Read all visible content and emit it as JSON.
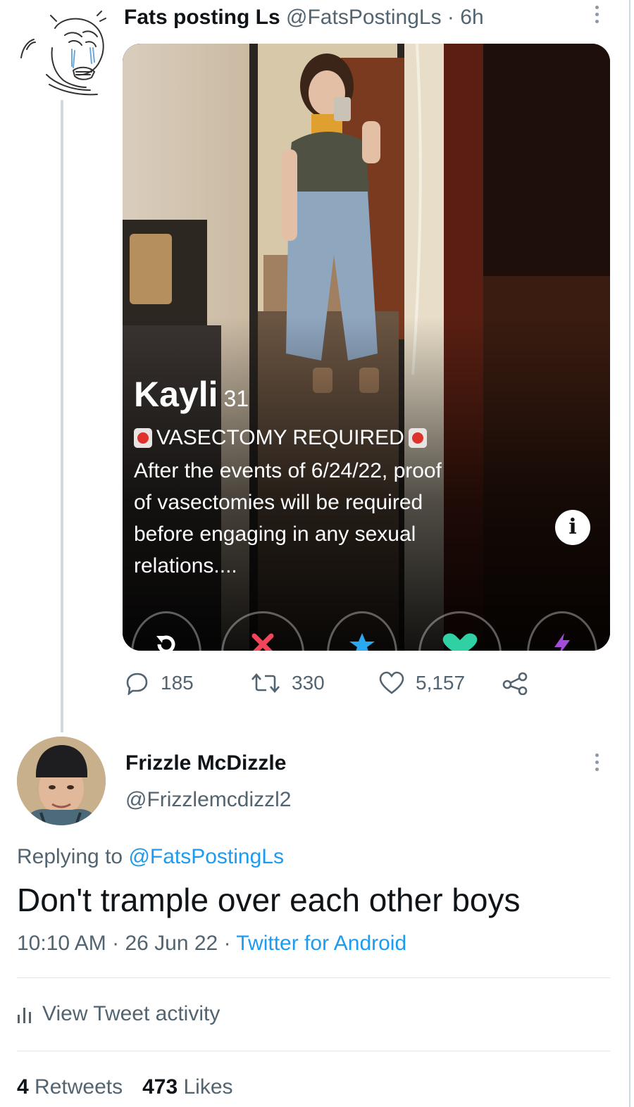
{
  "tweet1": {
    "author_name": "Fats posting Ls",
    "handle": "@FatsPostingLs",
    "separator": "·",
    "time": "6h",
    "media": {
      "profile_name": "Kayli",
      "profile_age": "31",
      "tag": "VASECTOMY REQUIRED",
      "bio_lines": [
        "After the events of 6/24/22, proof",
        "of vasectomies will be required",
        "before engaging in any sexual",
        "relations...."
      ],
      "info_glyph": "i"
    },
    "stats": {
      "replies": "185",
      "retweets": "330",
      "likes": "5,157"
    }
  },
  "tweet2": {
    "author_name": "Frizzle McDizzle",
    "handle": "@Frizzlemcdizzl2",
    "replying_prefix": "Replying to",
    "replying_to": "@FatsPostingLs",
    "text": "Don't trample over each other boys",
    "time": "10:10 AM",
    "date": "26 Jun 22",
    "dot": "·",
    "source": "Twitter for Android",
    "activity_label": "View Tweet activity",
    "retweets_count": "4",
    "retweets_label": "Retweets",
    "likes_count": "473",
    "likes_label": "Likes"
  },
  "colors": {
    "primary_text": "#0f1419",
    "secondary_text": "#536471",
    "link": "#1d9bf0",
    "divider": "#dfe4e8"
  },
  "icons": [
    "more-icon",
    "reply-icon",
    "retweet-icon",
    "like-icon",
    "share-icon",
    "activity-icon",
    "rewind-icon",
    "nope-icon",
    "super-like-icon",
    "like-heart-icon",
    "boost-icon",
    "siren-icon",
    "info-icon"
  ]
}
